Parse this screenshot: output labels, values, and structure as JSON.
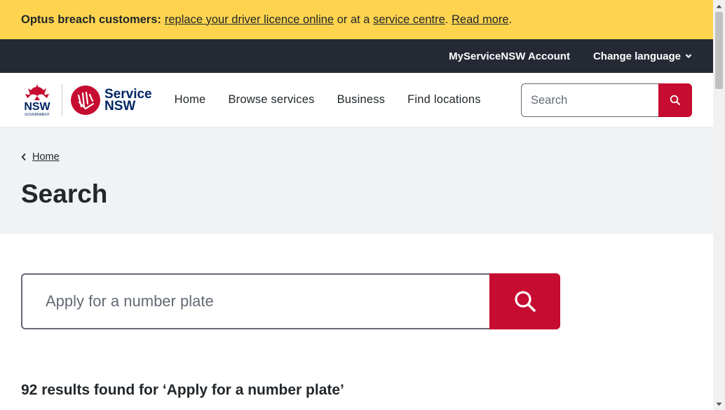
{
  "alert": {
    "bold": "Optus breach customers:",
    "link1": "replace your driver licence online",
    "mid": "or at a",
    "link2": "service centre",
    "period": ".",
    "link3": "Read more",
    "end": "."
  },
  "utility": {
    "account": "MyServiceNSW Account",
    "language": "Change language"
  },
  "brand": {
    "nsw_text": "NSW",
    "government_text": "GOVERNMENT",
    "service_line1": "Service",
    "service_line2": "NSW",
    "red": "#c60c30",
    "navy": "#002664"
  },
  "nav": {
    "items": [
      "Home",
      "Browse services",
      "Business",
      "Find locations"
    ]
  },
  "header_search": {
    "placeholder": "Search"
  },
  "breadcrumb": {
    "home": "Home"
  },
  "page_title": "Search",
  "main_search": {
    "value": "Apply for a number plate"
  },
  "results": {
    "text": "92 results found for ‘Apply for a number plate’"
  },
  "colors": {
    "alert_bg": "#fed44f",
    "utility_bg": "#242934",
    "hero_bg": "#f0f3f6",
    "accent": "#c60c30"
  }
}
